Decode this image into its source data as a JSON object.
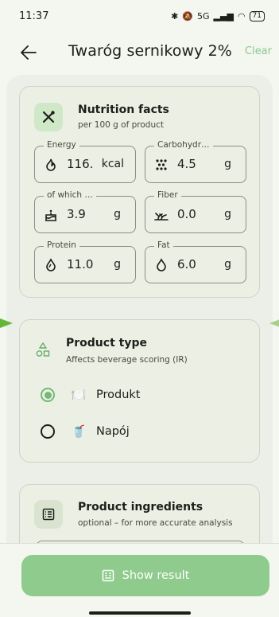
{
  "status_bar": {
    "time": "11:37",
    "signal_label": "5G",
    "battery": "71"
  },
  "header": {
    "title": "Twaróg sernikowy 2%",
    "clear_label": "Clear"
  },
  "nutrition": {
    "title": "Nutrition facts",
    "subtitle": "per 100 g of product",
    "fields": [
      {
        "label": "Energy",
        "value": "116.",
        "unit": "kcal",
        "icon": "flame-icon"
      },
      {
        "label": "Carbohydr…",
        "value": "4.5",
        "unit": "g",
        "icon": "grain-icon"
      },
      {
        "label": "of which …",
        "value": "3.9",
        "unit": "g",
        "icon": "cake-icon"
      },
      {
        "label": "Fiber",
        "value": "0.0",
        "unit": "g",
        "icon": "sprout-icon"
      },
      {
        "label": "Protein",
        "value": "11.0",
        "unit": "g",
        "icon": "drop-icon"
      },
      {
        "label": "Fat",
        "value": "6.0",
        "unit": "g",
        "icon": "oil-drop-icon"
      }
    ]
  },
  "product_type": {
    "title": "Product type",
    "subtitle": "Affects beverage scoring (IR)",
    "options": [
      {
        "label": "Produkt",
        "emoji": "🍽️",
        "selected": true
      },
      {
        "label": "Napój",
        "emoji": "🥤",
        "selected": false
      }
    ]
  },
  "ingredients": {
    "title": "Product ingredients",
    "subtitle": "optional – for more accurate analysis"
  },
  "action": {
    "show_result_label": "Show result"
  },
  "colors": {
    "accent": "#8fcb8c",
    "clear_text": "#8dc98d",
    "card_bg": "#ecf0e4",
    "icon_tile": "#cfe8c8"
  }
}
